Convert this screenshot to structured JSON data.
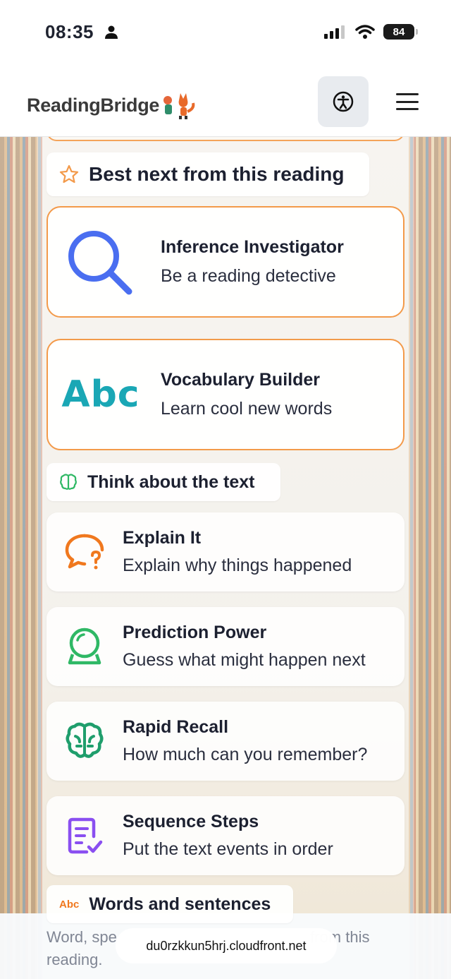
{
  "status": {
    "time": "08:35",
    "battery": "84"
  },
  "header": {
    "logo_text": "ReadingBridge"
  },
  "sections": {
    "best_next": "Best next from this reading",
    "think": "Think about the text",
    "words": "Words and sentences"
  },
  "featured": [
    {
      "title": "Inference Investigator",
      "subtitle": "Be a reading detective",
      "icon": "magnifier-icon"
    },
    {
      "title": "Vocabulary Builder",
      "subtitle": "Learn cool new words",
      "icon": "abc-icon",
      "icon_text": "Abc"
    }
  ],
  "activities": [
    {
      "title": "Explain It",
      "subtitle": "Explain why things happened",
      "icon": "speech-question-icon"
    },
    {
      "title": "Prediction Power",
      "subtitle": "Guess what might happen next",
      "icon": "crystal-ball-icon"
    },
    {
      "title": "Rapid Recall",
      "subtitle": "How much can you remember?",
      "icon": "brain-icon"
    },
    {
      "title": "Sequence Steps",
      "subtitle": "Put the text events in order",
      "icon": "ordered-list-icon"
    }
  ],
  "words_icon_text": "Abc",
  "bottom": {
    "text_left": "Word, spe",
    "text_right": "from this",
    "text_line2": "reading.",
    "url": "du0rzkkun5hrj.cloudfront.net"
  },
  "colors": {
    "orange": "#f39a4a",
    "blue": "#4a6ef0",
    "teal": "#1aa7b5",
    "green": "#2fb865",
    "purple": "#8a4ff0"
  }
}
